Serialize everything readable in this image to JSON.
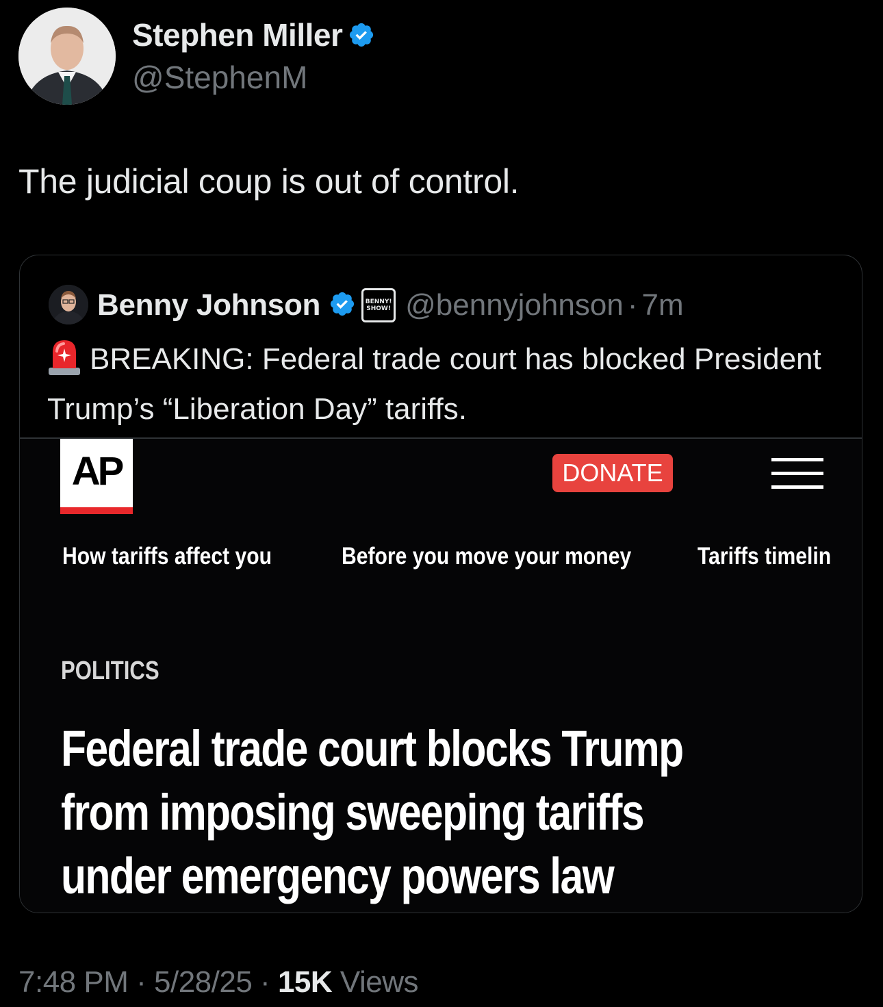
{
  "author": {
    "name": "Stephen Miller",
    "handle": "@StephenM",
    "verified_color": "#1d9bf0",
    "avatar_icon": "profile-photo"
  },
  "tweet": {
    "text": "The judicial coup is out of control."
  },
  "quoted_tweet": {
    "name": "Benny Johnson",
    "badge_text": [
      "BENNY!",
      "SHOW!"
    ],
    "handle": "@bennyjohnson",
    "separator": "·",
    "time": "7m",
    "emoji_icon": "police-siren-icon",
    "text": "BREAKING: Federal trade court has blocked President Trump’s “Liberation Day” tariffs."
  },
  "article_image": {
    "logo_text": "AP",
    "donate_label": "DONATE",
    "nav_items": [
      "How tariffs affect you",
      "Before you move your money",
      "Tariffs timelin"
    ],
    "section": "POLITICS",
    "headline_lines": [
      "Federal trade court blocks Trump",
      "from imposing sweeping tariffs",
      "under emergency powers law"
    ]
  },
  "footer": {
    "time": "7:48 PM",
    "sep1": "·",
    "date": "5/28/25",
    "sep2": "·",
    "views_count": "15K",
    "views_label": "Views"
  }
}
